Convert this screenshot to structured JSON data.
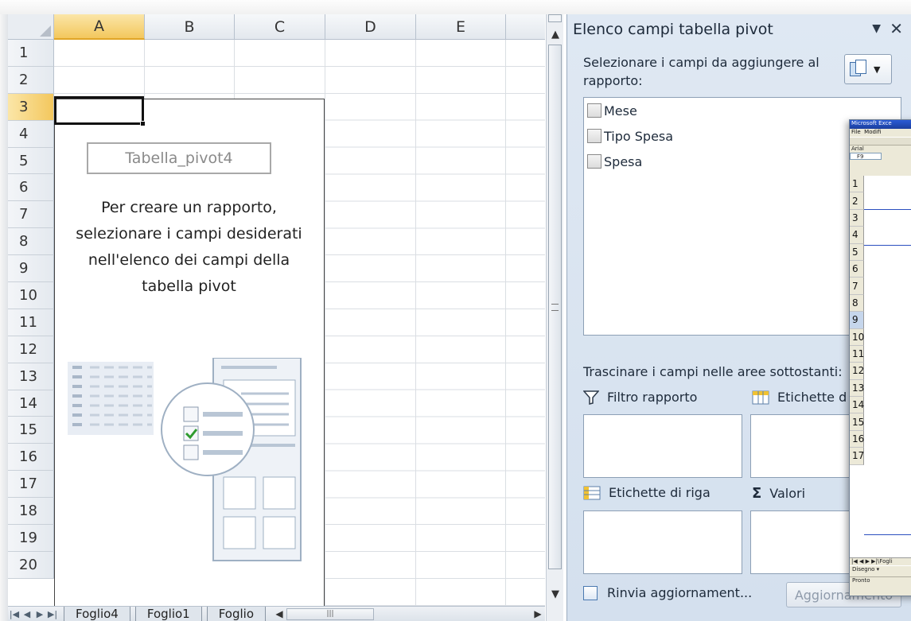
{
  "spreadsheet": {
    "columns": [
      "A",
      "B",
      "C",
      "D",
      "E"
    ],
    "rows": [
      "1",
      "2",
      "3",
      "4",
      "5",
      "6",
      "7",
      "8",
      "9",
      "10",
      "11",
      "12",
      "13",
      "14",
      "15",
      "16",
      "17",
      "18",
      "19",
      "20"
    ],
    "pivot_placeholder": {
      "name": "Tabella_pivot4",
      "message": "Per creare un rapporto, selezionare i campi desiderati nell'elenco dei campi della tabella pivot"
    },
    "sheet_tabs": [
      "Foglio4",
      "Foglio1",
      "Foglio"
    ]
  },
  "field_list_pane": {
    "title": "Elenco campi tabella pivot",
    "instruction": "Selezionare i campi da aggiungere al rapporto:",
    "fields": [
      {
        "label": "Mese",
        "checked": false
      },
      {
        "label": "Tipo Spesa",
        "checked": false
      },
      {
        "label": "Spesa",
        "checked": false
      }
    ],
    "drag_instruction": "Trascinare i campi nelle aree sottostanti:",
    "areas": {
      "report_filter": "Filtro rapporto",
      "column_labels": "Etichette d",
      "row_labels": "Etichette di riga",
      "values": "Valori"
    },
    "defer_update_label": "Rinvia aggiornament...",
    "update_button_label": "Aggiornamento"
  },
  "old_excel_window": {
    "title": "Microsoft Exce",
    "menu_file": "File",
    "menu_edit": "Modifi",
    "font_name": "Arial",
    "cell_ref": "F9",
    "rows": [
      "1",
      "2",
      "3",
      "4",
      "5",
      "6",
      "7",
      "8",
      "9",
      "10",
      "11",
      "12",
      "13",
      "14",
      "15",
      "16",
      "17"
    ],
    "sheet_tab": "Fogli",
    "draw_label": "Disegno",
    "status": "Pronto"
  },
  "colors": {
    "active_header": "#f3c75d",
    "pane_background": "#d4e0ee",
    "update_button_text": "#8f9bab"
  }
}
